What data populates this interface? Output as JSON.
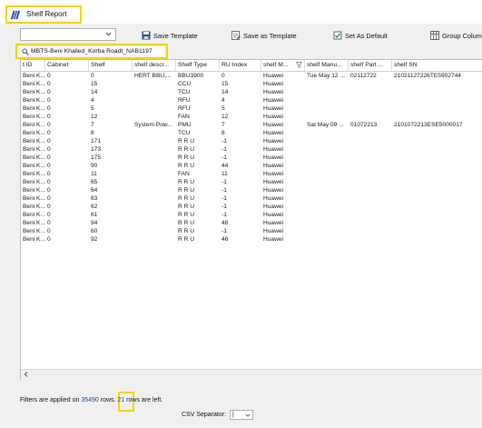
{
  "window": {
    "title": "Shelf Report"
  },
  "toolbar": {
    "save_template": "Save Template",
    "save_as_template": "Save as Template",
    "set_as_default": "Set As Default",
    "group_columns": "Group Column"
  },
  "search": {
    "value": "MBTS-Beni Khalled_Korba Roadt_NAB1197"
  },
  "table": {
    "columns": [
      "t ID",
      "Cabinet",
      "Shelf",
      "shelf descr...",
      "Shelf Type",
      "RU Index",
      "shelf M...",
      "shelf Manu...",
      "shelf Part ...",
      "shelf SN"
    ],
    "rows": [
      [
        "Beni K...",
        "0",
        "0",
        "HERT BBU,...",
        "BBU3900",
        "0",
        "Huawei",
        "Tue May 12 ...",
        "02112722",
        "21021127226TE5902744"
      ],
      [
        "Beni K...",
        "0",
        "15",
        "",
        "CCU",
        "15",
        "Huawei",
        "",
        "",
        ""
      ],
      [
        "Beni K...",
        "0",
        "14",
        "",
        "TCU",
        "14",
        "Huawei",
        "",
        "",
        ""
      ],
      [
        "Beni K...",
        "0",
        "4",
        "",
        "RFU",
        "4",
        "Huawei",
        "",
        "",
        ""
      ],
      [
        "Beni K...",
        "0",
        "5",
        "",
        "RFU",
        "5",
        "Huawei",
        "",
        "",
        ""
      ],
      [
        "Beni K...",
        "0",
        "12",
        "",
        "FAN",
        "12",
        "Huawei",
        "",
        "",
        ""
      ],
      [
        "Beni K...",
        "0",
        "7",
        "System Pow...",
        "PMU",
        "7",
        "Huawei",
        "Sat May 09 ...",
        "01072213",
        "2101072213ESE5000017"
      ],
      [
        "Beni K...",
        "0",
        "8",
        "",
        "TCU",
        "8",
        "Huawei",
        "",
        "",
        ""
      ],
      [
        "Beni K...",
        "0",
        "171",
        "",
        "R R U",
        "-1",
        "Huawei",
        "",
        "",
        ""
      ],
      [
        "Beni K...",
        "0",
        "173",
        "",
        "R R U",
        "-1",
        "Huawei",
        "",
        "",
        ""
      ],
      [
        "Beni K...",
        "0",
        "175",
        "",
        "R R U",
        "-1",
        "Huawei",
        "",
        "",
        ""
      ],
      [
        "Beni K...",
        "0",
        "90",
        "",
        "R R U",
        "44",
        "Huawei",
        "",
        "",
        ""
      ],
      [
        "Beni K...",
        "0",
        "11",
        "",
        "FAN",
        "11",
        "Huawei",
        "",
        "",
        ""
      ],
      [
        "Beni K...",
        "0",
        "65",
        "",
        "R R U",
        "-1",
        "Huawei",
        "",
        "",
        ""
      ],
      [
        "Beni K...",
        "0",
        "64",
        "",
        "R R U",
        "-1",
        "Huawei",
        "",
        "",
        ""
      ],
      [
        "Beni K...",
        "0",
        "63",
        "",
        "R R U",
        "-1",
        "Huawei",
        "",
        "",
        ""
      ],
      [
        "Beni K...",
        "0",
        "62",
        "",
        "R R U",
        "-1",
        "Huawei",
        "",
        "",
        ""
      ],
      [
        "Beni K...",
        "0",
        "61",
        "",
        "R R U",
        "-1",
        "Huawei",
        "",
        "",
        ""
      ],
      [
        "Beni K...",
        "0",
        "94",
        "",
        "R R U",
        "48",
        "Huawei",
        "",
        "",
        ""
      ],
      [
        "Beni K...",
        "0",
        "60",
        "",
        "R R U",
        "-1",
        "Huawei",
        "",
        "",
        ""
      ],
      [
        "Beni K...",
        "0",
        "92",
        "",
        "R R U",
        "46",
        "Huawei",
        "",
        "",
        ""
      ]
    ]
  },
  "status": {
    "prefix": "Filters are applied on ",
    "total": "35490",
    "middle": " rows. ",
    "left_count": "21",
    "suffix": " rows are left."
  },
  "csv": {
    "label": "CSV Separator:",
    "value": "|"
  },
  "colors": {
    "highlight": "#f2d40d",
    "link_number": "#1a3fb5",
    "grid_bg": "#ffffff",
    "chrome_bg": "#f0f0f0"
  },
  "icons": [
    "app-icon",
    "chevron-down-icon",
    "save-template-icon",
    "save-as-template-icon",
    "set-default-icon",
    "group-columns-icon",
    "search-icon",
    "filter-icon",
    "scroll-left-arrow-icon"
  ]
}
